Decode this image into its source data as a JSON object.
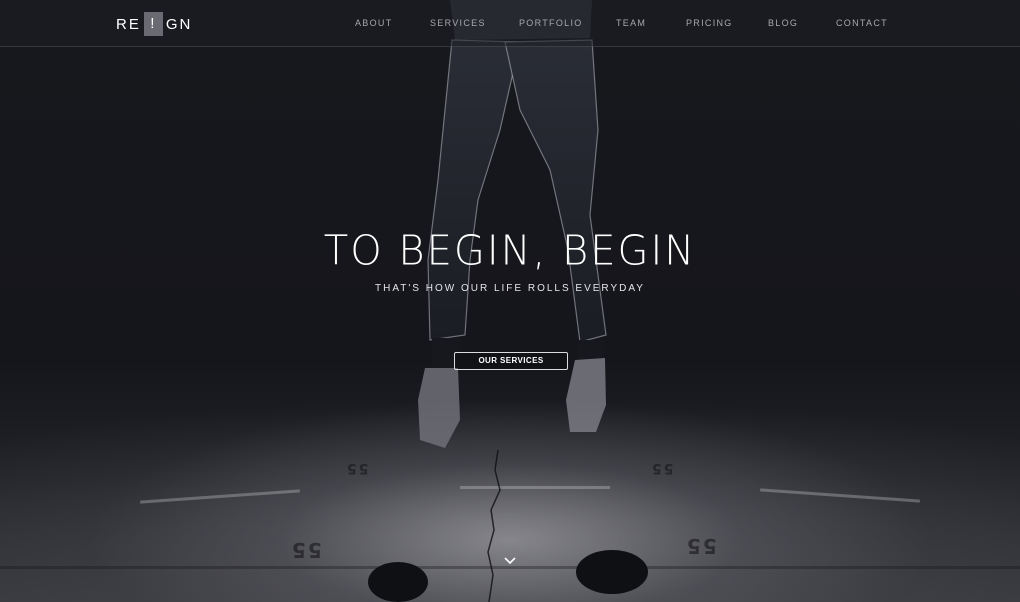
{
  "brand": {
    "logo_left": "RE",
    "logo_mid": "!",
    "logo_right": "GN"
  },
  "nav": {
    "items": [
      {
        "label": "ABOUT"
      },
      {
        "label": "SERVICES"
      },
      {
        "label": "PORTFOLIO"
      },
      {
        "label": "TEAM"
      },
      {
        "label": "PRICING"
      },
      {
        "label": "BLOG"
      },
      {
        "label": "CONTACT"
      }
    ]
  },
  "hero": {
    "title": "TO BEGIN, BEGIN",
    "subtitle": "THAT'S HOW OUR LIFE ROLLS EVERYDAY",
    "cta_label": "OUR SERVICES"
  },
  "floor": {
    "marks": [
      "55",
      "55",
      "55",
      "55"
    ]
  },
  "icons": {
    "scroll": "chevron-down-icon"
  },
  "colors": {
    "background": "#15161b",
    "nav_text": "#a7a8ad",
    "logo_badge": "#6a6b72"
  }
}
